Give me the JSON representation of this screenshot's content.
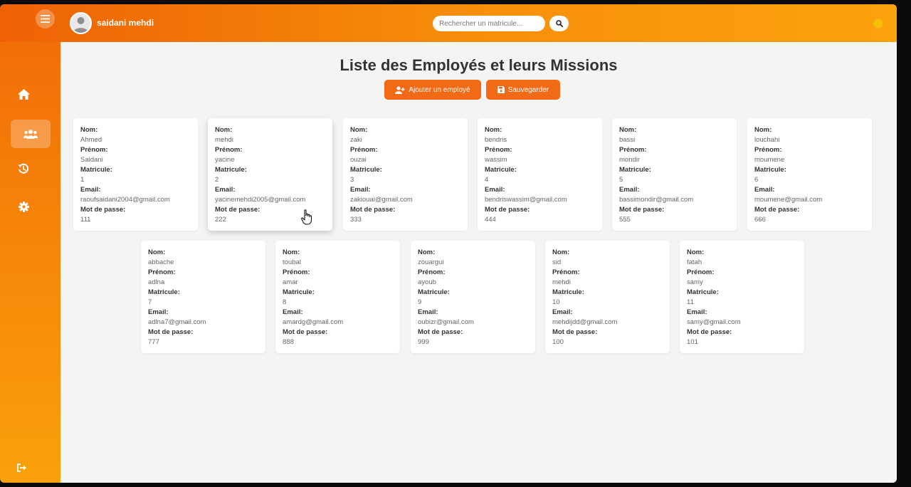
{
  "header": {
    "username": "saidani mehdi",
    "search_placeholder": "Rechercher un matricule..."
  },
  "sidebar": {
    "items": [
      {
        "name": "home",
        "icon": "home-icon"
      },
      {
        "name": "employees",
        "icon": "users-icon",
        "active": true
      },
      {
        "name": "history",
        "icon": "history-icon"
      },
      {
        "name": "settings",
        "icon": "gear-icon"
      },
      {
        "name": "logout",
        "icon": "logout-icon"
      }
    ]
  },
  "main": {
    "title": "Liste des Employés et leurs Missions",
    "add_button": "Ajouter un employé",
    "save_button": "Sauvegarder"
  },
  "labels": {
    "nom": "Nom:",
    "prenom": "Prénom:",
    "matricule": "Matricule:",
    "email": "Email:",
    "password": "Mot de passe:"
  },
  "employees": [
    {
      "nom": "Ahmed",
      "prenom": "Saidani",
      "matricule": "1",
      "email": "raoufsaidani2004@gmail.com",
      "password": "111"
    },
    {
      "nom": "mehdi",
      "prenom": "yacine",
      "matricule": "2",
      "email": "yacinemehdi2005@gmail.com",
      "password": "222"
    },
    {
      "nom": "zaki",
      "prenom": "ouzai",
      "matricule": "3",
      "email": "zakiouai@gmail.com",
      "password": "333"
    },
    {
      "nom": "bendris",
      "prenom": "wassim",
      "matricule": "4",
      "email": "bendriswassim@gmail.com",
      "password": "444"
    },
    {
      "nom": "bassi",
      "prenom": "mondir",
      "matricule": "5",
      "email": "bassimondir@gmail.com",
      "password": "555"
    },
    {
      "nom": "louchahi",
      "prenom": "moumene",
      "matricule": "6",
      "email": "moumene@gmail.com",
      "password": "666"
    },
    {
      "nom": "abbache",
      "prenom": "adlna",
      "matricule": "7",
      "email": "adlna7@gmail.com",
      "password": "777"
    },
    {
      "nom": "toubal",
      "prenom": "amar",
      "matricule": "8",
      "email": "amardg@gmail.com",
      "password": "888"
    },
    {
      "nom": "zouargui",
      "prenom": "ayoub",
      "matricule": "9",
      "email": "oubizr@gmail.com",
      "password": "999"
    },
    {
      "nom": "sid",
      "prenom": "mehdi",
      "matricule": "10",
      "email": "mehdijdd@gmail.com",
      "password": "100"
    },
    {
      "nom": "fatah",
      "prenom": "samy",
      "matricule": "11",
      "email": "samy@gmail.com",
      "password": "101"
    }
  ],
  "colors": {
    "accent": "#f26a15",
    "header_start": "#ee6205",
    "header_end": "#fba20c",
    "background": "#f4f4f4"
  }
}
